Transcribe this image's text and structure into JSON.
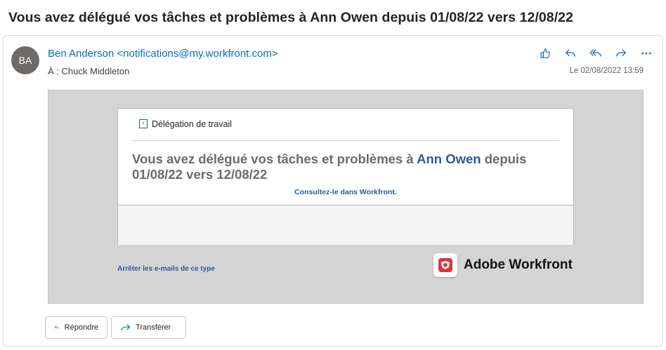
{
  "email": {
    "subject": "Vous avez délégué vos tâches et problèmes à Ann Owen depuis 01/08/22 vers 12/08/22",
    "sender": {
      "initials": "BA",
      "display": "Ben Anderson <notifications@my.workfront.com>"
    },
    "recipients": "À : Chuck Middleton",
    "date": "Le 02/08/2022 13:59",
    "actions": [
      {
        "name": "like",
        "icon": "thumbs-up-icon"
      },
      {
        "name": "reply",
        "icon": "reply-icon"
      },
      {
        "name": "reply-all",
        "icon": "reply-all-icon"
      },
      {
        "name": "forward",
        "icon": "forward-icon"
      },
      {
        "name": "more",
        "icon": "more-icon"
      }
    ],
    "accent_color": "#0f6cbd"
  },
  "body": {
    "section_title": "Délégation de travail",
    "message_prefix": "Vous avez délégué vos tâches et problèmes à ",
    "message_name": "Ann Owen",
    "message_suffix": " depuis 01/08/22 vers 12/08/22",
    "consult_link": "Consultez-le dans Workfront.",
    "stop_link": "Arrêter les e-mails de ce type",
    "brand_name": "Adobe Workfront",
    "brand_color": "#d9383a",
    "link_color": "#2d5b9a"
  },
  "footer": {
    "reply_label": "Répondre",
    "forward_label": "Transférer"
  }
}
